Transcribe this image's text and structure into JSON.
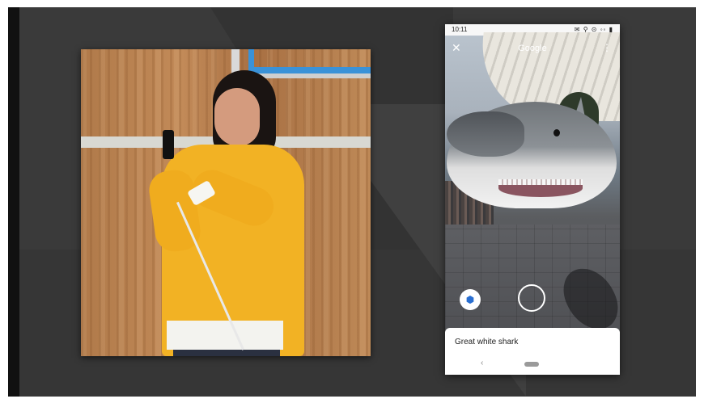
{
  "phone": {
    "status_time": "10:11",
    "status_icons": "✉ ⚲ ⊙ ◦◦ ▮",
    "app_title": "Google",
    "close_icon_glyph": "✕",
    "more_icon_glyph": "⋮",
    "cube_icon_glyph": "⬢",
    "result_label": "Great white shark",
    "back_glyph": "‹"
  },
  "colors": {
    "stage_bg": "#3a3a3a",
    "sweater": "#f2b224",
    "accent_blue": "#3a92d8"
  },
  "icons": [
    "close-icon",
    "more-options-icon",
    "view-3d-icon",
    "shutter-icon",
    "back-icon",
    "home-icon"
  ]
}
